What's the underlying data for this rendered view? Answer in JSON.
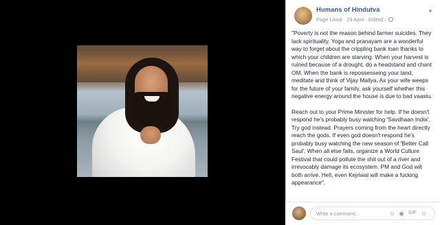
{
  "post": {
    "page_name": "Humans of Hindutva",
    "meta_liked": "Page Liked",
    "meta_date": "29 April",
    "meta_edited": "Edited",
    "paragraphs": [
      "\"Poverty is not the reason behind farmer suicides. They lack spirituality. Yoga and pranayam are a wonderful way to forget about the crippling bank loan thanks to which your children are starving. When your harvest is ruined because of a drought, do a headstand and chant OM. When the bank is repossesseing your land, meditate and think of Vijay Mallya. As your wife weeps for the future of your family, ask yourself whether this negative energy around the house is due to bad vaastu.",
      "Reach out to your Prime Minister for help. If he doesn't respond he's probably busy watching 'Savdhaan India'. Try god instead. Prayers coming from the heart directly reach the gods. If even god doesn't respond he's probably busy watching the new season of 'Better Call Saul'. When all else fails, organize a World Culture Festival that could pollute the shit out of a river and irrevocably damage its ecosystem. PM and God will both arrive. Hell, even Kejriwal will make a fucking appearance\"."
    ]
  },
  "comment": {
    "placeholder": "Write a comment...",
    "icons": [
      "emoji-icon",
      "camera-icon",
      "gif-icon",
      "sticker-icon"
    ]
  },
  "photo": {
    "description_icon": "photo-of-smiling-man"
  }
}
